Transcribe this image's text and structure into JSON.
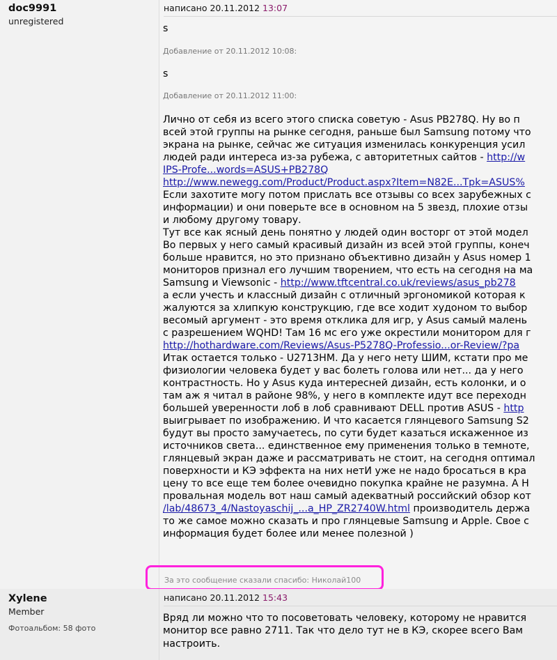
{
  "posts": [
    {
      "username": "doc9991",
      "usertitle": "unregistered",
      "written_label": "написано 20.11.2012",
      "written_time": "13:07",
      "lines_top": [
        "s"
      ],
      "addition1": "Добавление от 20.11.2012 10:08:",
      "lines_mid": [
        "s"
      ],
      "addition2": "Добавление от 20.11.2012 11:00:",
      "body": [
        {
          "t": "Лично от себя из всего этого списка советую - Asus PB278Q. Ну во п"
        },
        {
          "t": "всей этой группы на рынке сегодня, раньше был Samsung потому что"
        },
        {
          "t": "экрана на рынке, сейчас же ситуация изменилась конкуренция усил"
        },
        {
          "t": "людей ради интереса из-за рубежа, с авторитетных сайтов - ",
          "link": "http://w"
        },
        {
          "t": "",
          "link": "IPS-Profe...words=ASUS+PB278Q"
        },
        {
          "t": "",
          "link": "http://www.newegg.com/Product/Product.aspx?Item=N82E...Tpk=ASUS%"
        },
        {
          "t": "Если захотите могу потом прислать все отзывы со всех зарубежных с"
        },
        {
          "t": "информации) и они поверьте все в основном на 5 звезд, плохие отзы"
        },
        {
          "t": "и любому другому товару."
        },
        {
          "t": "Тут все как ясный день понятно у людей один восторг от этой модел"
        },
        {
          "t": "Во первых у него самый красивый дизайн из всей этой группы, конеч"
        },
        {
          "t": "больше нравится, но это признано объективно дизайн у Asus номер 1"
        },
        {
          "t": "мониторов признал его лучшим творением, что есть на сегодня на ма"
        },
        {
          "t": "Samsung и Viewsonic - ",
          "link": "http://www.tftcentral.co.uk/reviews/asus_pb278"
        },
        {
          "t": "а если учесть и классный дизайн с отличный эргономикой которая к"
        },
        {
          "t": "жалуются за хлипкую конструкцию, где все ходит худоном то выбор"
        },
        {
          "t": "весомый аргумент - это время отклика для игр, у Asus самый малень"
        },
        {
          "t": "с разрешением WQHD! Там 16 мс его уже окрестили монитором для г"
        },
        {
          "t": "",
          "link": "http://hothardware.com/Reviews/Asus-P5278Q-Professio...or-Review/?pa"
        },
        {
          "t": "Итак остается только - U2713HM. Да у него нету ШИМ, кстати про ме"
        },
        {
          "t": "физиологии человека будет у вас болеть голова или нет... да у него"
        },
        {
          "t": "контрастность. Но у Asus куда интересней дизайн, есть колонки, и о"
        },
        {
          "t": "там аж я читал в районе 98%, у него в комплекте идут все переходн"
        },
        {
          "t": "большей уверенности лоб в лоб сравнивают DELL против ASUS - ",
          "link": "http"
        },
        {
          "t": "выигрывает по изображению. И что касается глянцевого Samsung S2"
        },
        {
          "t": "будут вы просто замучаетесь, по сути будет казаться искаженное из"
        },
        {
          "t": "источников света... единственное ему применения только в темноте,"
        },
        {
          "t": "глянцевый экран даже и рассматривать не стоит, на сегодня оптимал"
        },
        {
          "t": "поверхности и КЭ эффекта на них нетИ уже не надо бросаться в кра"
        },
        {
          "t": "цену то все еще тем более очевидно покупка крайне не разумна. А Н"
        },
        {
          "t": "провальная модель вот наш самый адекватный российский обзор кот"
        },
        {
          "t": "",
          "link": "/lab/48673_4/Nastoyaschij_...a_HP_ZR2740W.html",
          "after": " производитель держа"
        },
        {
          "t": "то же самое можно сказать и про глянцевые Samsung и Apple. Свое с"
        },
        {
          "t": "информация будет более или менее полезной )"
        }
      ],
      "thanks": "За это сообщение сказали спасибо: Николай100"
    },
    {
      "username": "Xylene",
      "usertitle": "Member",
      "album": "Фотоальбом: 58 фото",
      "written_label": "написано 20.11.2012",
      "written_time": "15:43",
      "body": [
        {
          "t": "Вряд ли можно что то посоветовать человеку, которому не нравится"
        },
        {
          "t": "монитор все равно 2711. Так что дело тут не в КЭ, скорее всего Вам"
        },
        {
          "t": "настроить."
        }
      ]
    }
  ],
  "colors": {
    "time": "#8a1a6a",
    "link": "#1a1aa8",
    "highlight": "#ff22dd"
  }
}
